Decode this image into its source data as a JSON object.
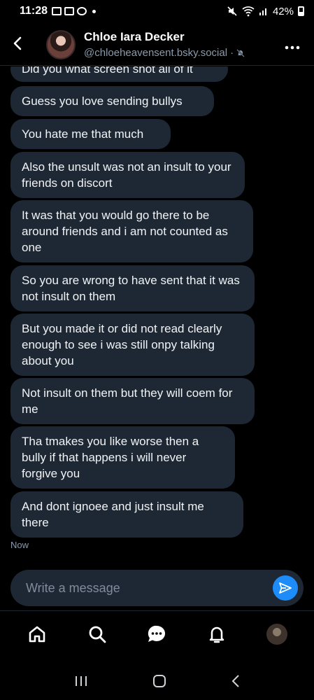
{
  "status_bar": {
    "time": "11:28",
    "battery": "42%"
  },
  "header": {
    "name": "Chloe Iara Decker",
    "handle": "@chloeheavensent.bsky.social",
    "separator": "·"
  },
  "messages": [
    "Did you what screen shot all of it",
    "Guess you love sending bullys",
    "You hate me that much",
    "Also the unsult was not an insult to your friends on discort",
    "It was that you would go there to be around friends and i am not counted as one",
    "So you are wrong to have sent that it was not insult on them",
    "But you made it or did not read clearly enough to see i was still onpy talking about you",
    "Not insult on them but they will coem for me",
    "Tha tmakes you like worse then a bully if that happens i will never forgive you",
    "And dont ignoee and just insult me there"
  ],
  "timestamp": "Now",
  "composer": {
    "placeholder": "Write a message"
  },
  "colors": {
    "background": "#000000",
    "bubble": "#1e2835",
    "accent": "#1d8cf8",
    "muted_text": "#8b9aab"
  },
  "icons": {
    "back": "chevron-left-icon",
    "more": "more-horizontal-icon",
    "mute": "bell-off-icon",
    "send": "send-icon",
    "nav": [
      "home-icon",
      "search-icon",
      "chat-icon",
      "bell-icon",
      "avatar"
    ]
  }
}
